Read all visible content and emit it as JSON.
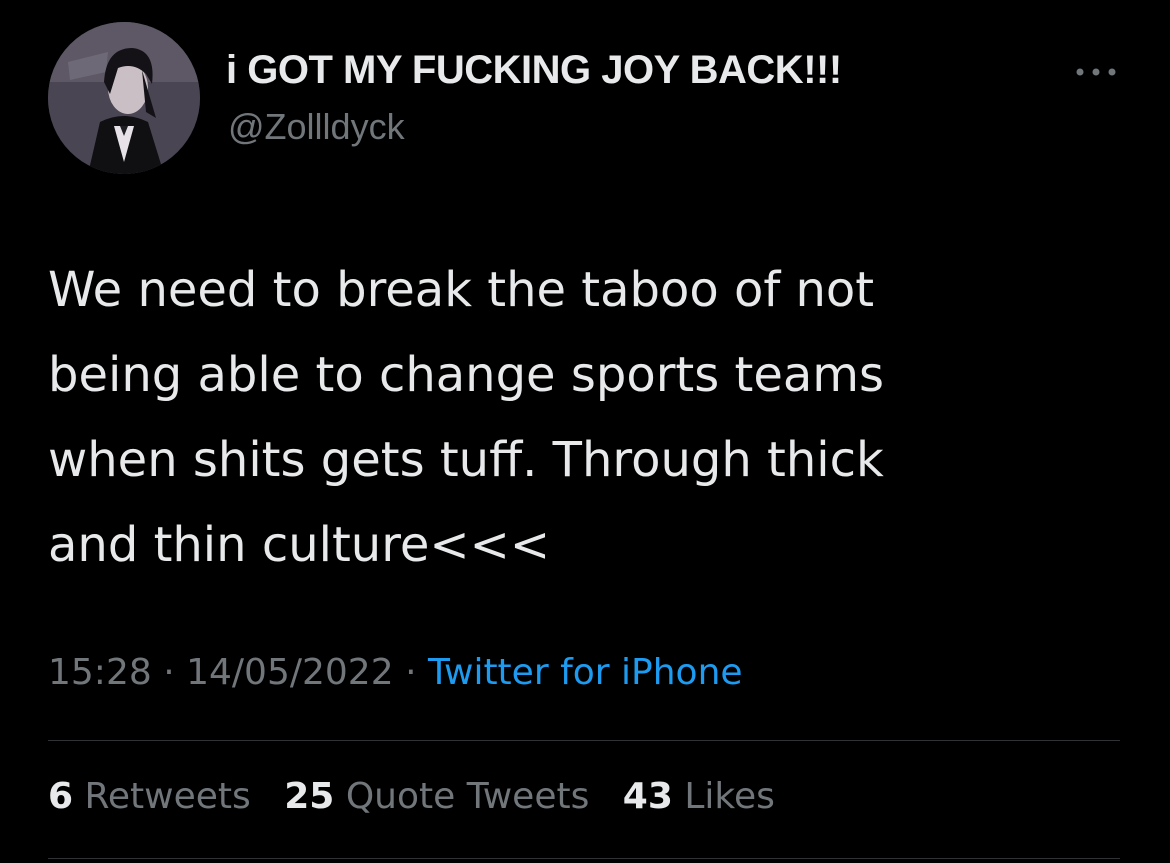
{
  "user": {
    "display_name": "i GOT MY FUCKING JOY BACK!!!",
    "handle": "@Zollldyck"
  },
  "tweet": {
    "text": "We need to break the taboo of not\nbeing able to change sports teams\nwhen shits gets tuff. Through thick\nand thin culture<<<",
    "time": "15:28",
    "separator": "·",
    "date": "14/05/2022",
    "source": "Twitter for iPhone"
  },
  "stats": [
    {
      "count": "6",
      "label": "Retweets"
    },
    {
      "count": "25",
      "label": "Quote Tweets"
    },
    {
      "count": "43",
      "label": "Likes"
    }
  ],
  "icons": {
    "more": "more-horizontal-icon"
  },
  "colors": {
    "background": "#000000",
    "primary_text": "#e7e9ea",
    "secondary_text": "#71767b",
    "link": "#1d9bf0",
    "divider": "#2f3336"
  }
}
